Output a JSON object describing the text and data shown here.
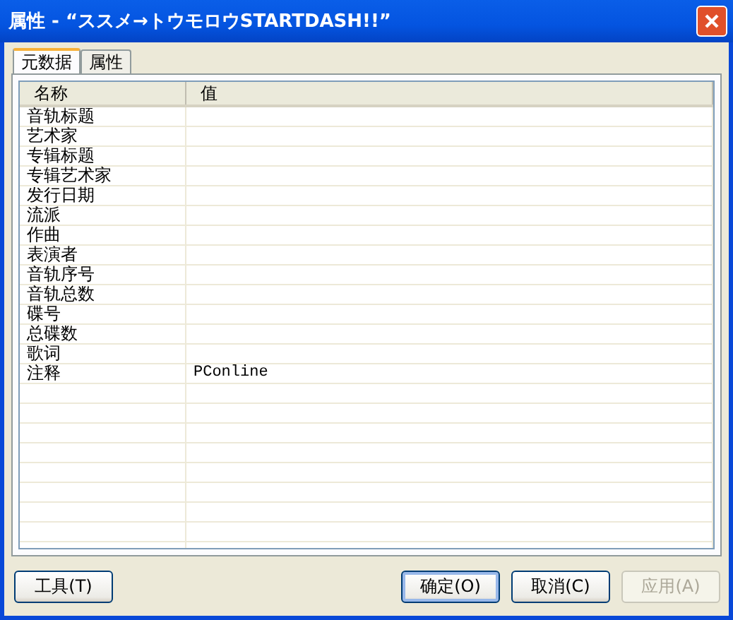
{
  "window": {
    "title": "属性 - “ススメ→トウモロウSTARTDASH!!”"
  },
  "tabs": [
    {
      "label": "元数据",
      "selected": true
    },
    {
      "label": "属性",
      "selected": false
    }
  ],
  "table": {
    "columns": [
      "名称",
      "值"
    ],
    "rows": [
      {
        "name": "音轨标题",
        "value": ""
      },
      {
        "name": "艺术家",
        "value": ""
      },
      {
        "name": "专辑标题",
        "value": ""
      },
      {
        "name": "专辑艺术家",
        "value": ""
      },
      {
        "name": "发行日期",
        "value": ""
      },
      {
        "name": "流派",
        "value": ""
      },
      {
        "name": "作曲",
        "value": ""
      },
      {
        "name": "表演者",
        "value": ""
      },
      {
        "name": "音轨序号",
        "value": ""
      },
      {
        "name": "音轨总数",
        "value": ""
      },
      {
        "name": "碟号",
        "value": ""
      },
      {
        "name": "总碟数",
        "value": ""
      },
      {
        "name": "歌词",
        "value": ""
      },
      {
        "name": "注释",
        "value": "PConline"
      }
    ]
  },
  "buttons": [
    {
      "label": "工具(T)",
      "disabled": false,
      "default": false
    },
    {
      "label": "确定(O)",
      "disabled": false,
      "default": true
    },
    {
      "label": "取消(C)",
      "disabled": false,
      "default": false
    },
    {
      "label": "应用(A)",
      "disabled": true,
      "default": false
    }
  ]
}
